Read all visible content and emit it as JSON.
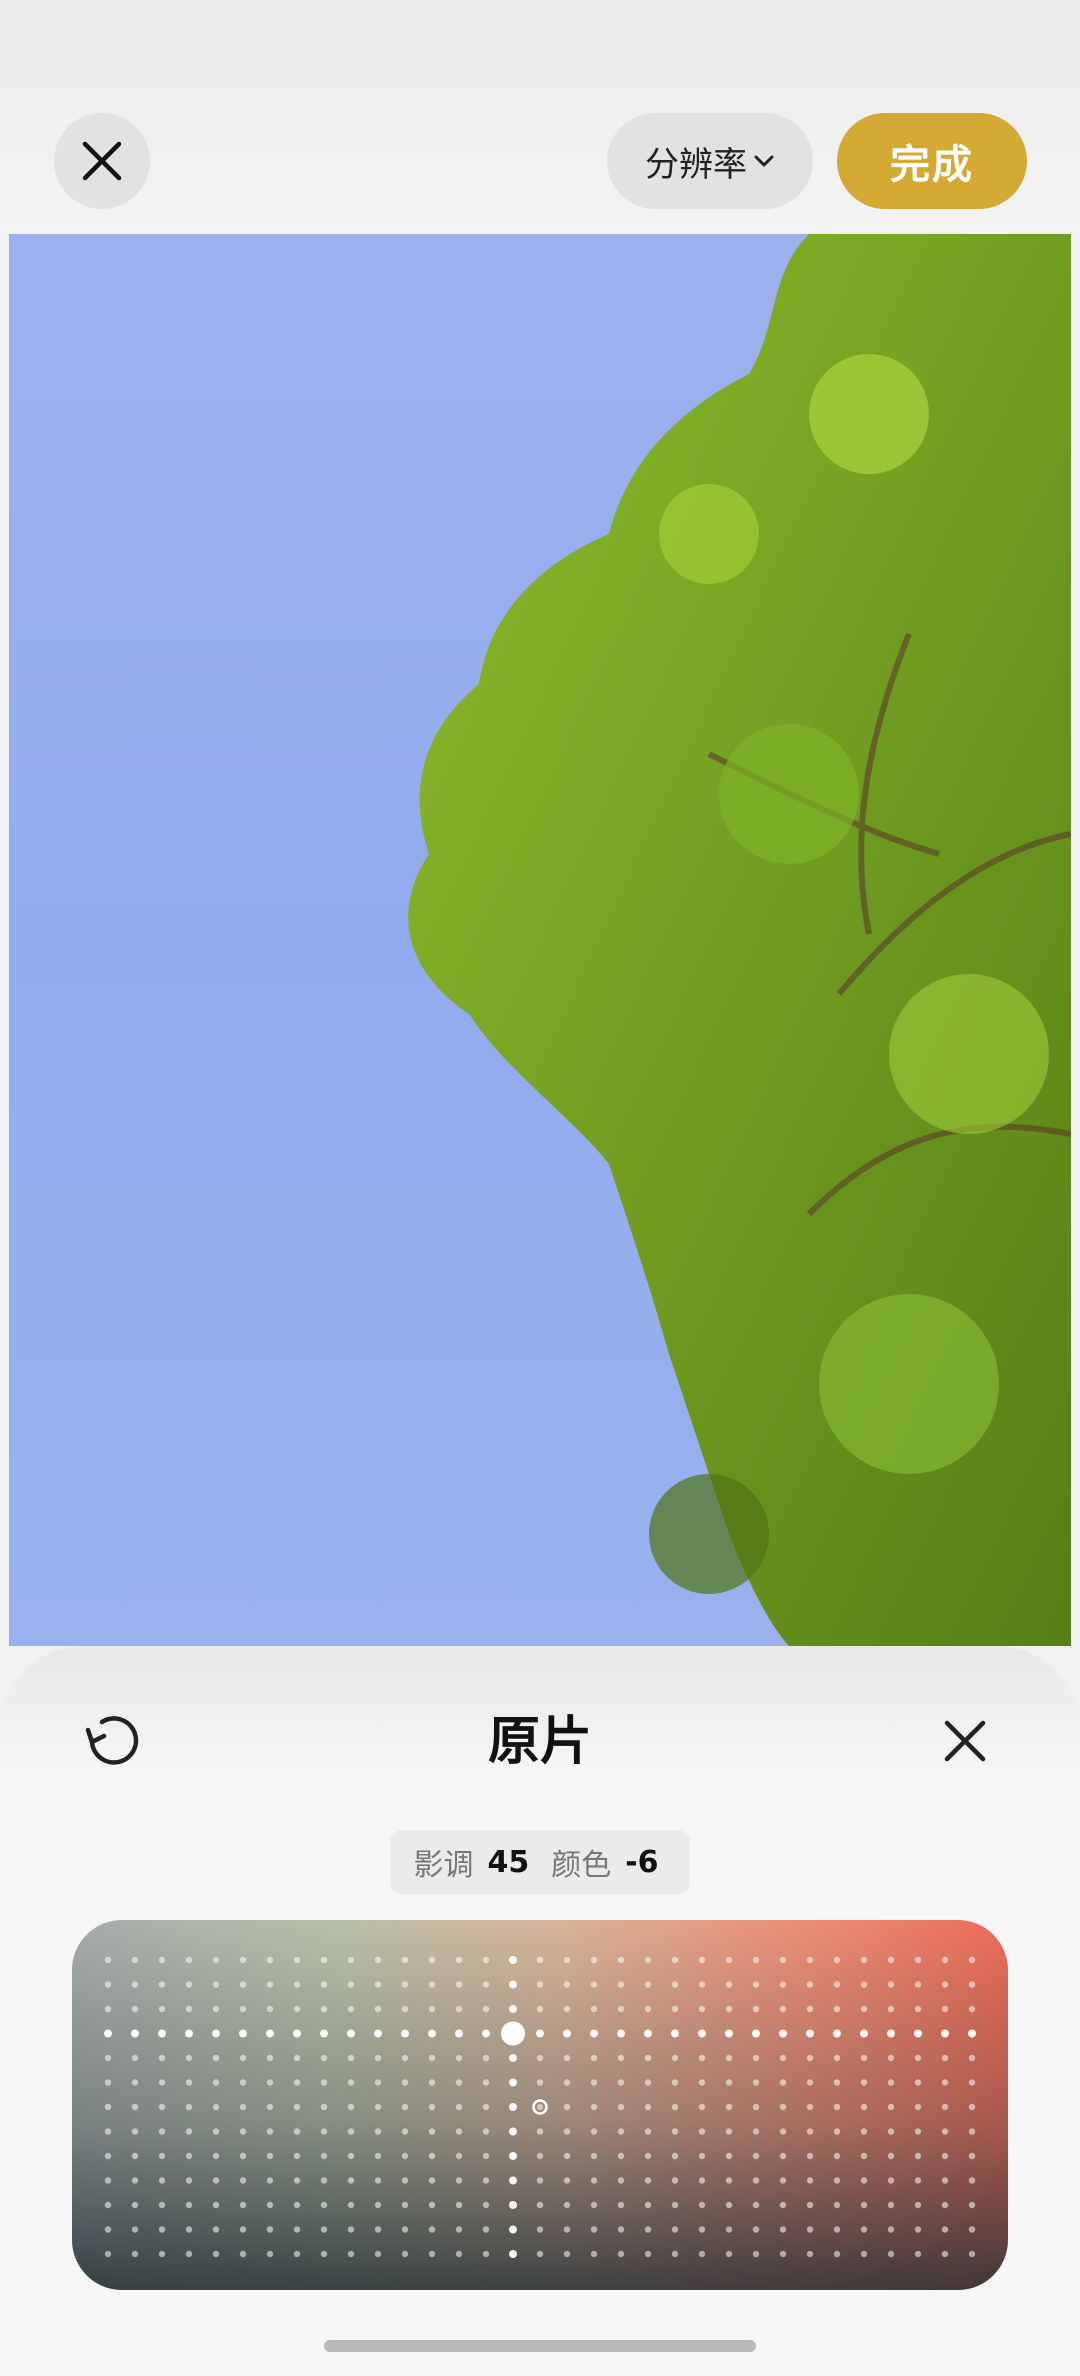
{
  "header": {
    "resolution_label": "分辨率",
    "done_label": "完成"
  },
  "panel": {
    "title": "原片",
    "tone_label": "影调",
    "tone_value": "45",
    "color_label": "颜色",
    "color_value": "-6"
  },
  "colors": {
    "accent": "#d4aa35",
    "sky": "#9db1ee",
    "foliage": "#6d9a1a"
  },
  "icons": {
    "close": "close-icon",
    "chevron": "chevron-down-icon",
    "undo": "undo-icon"
  }
}
